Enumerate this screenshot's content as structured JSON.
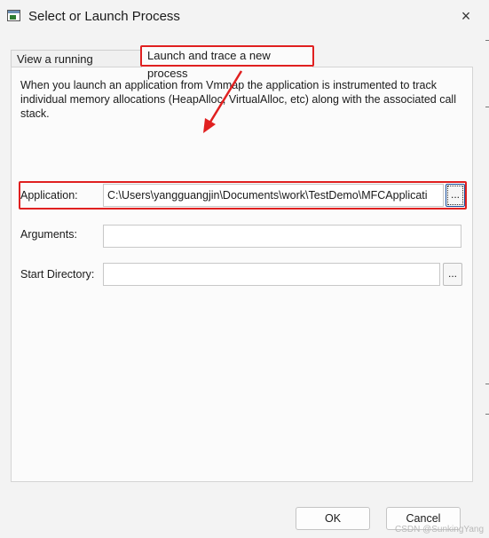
{
  "window": {
    "title": "Select or Launch Process",
    "close_icon": "×"
  },
  "tabs": [
    {
      "label": "View a running process",
      "active": false
    },
    {
      "label": "Launch and trace a new process",
      "active": true
    }
  ],
  "launch_panel": {
    "description": "When you launch an application from Vmmap the application is instrumented to track individual memory allocations (HeapAlloc, VirtualAlloc, etc) along with the associated call stack.",
    "application": {
      "label": "Application:",
      "value": "C:\\Users\\yangguangjin\\Documents\\work\\TestDemo\\MFCApplicati",
      "browse_label": "..."
    },
    "arguments": {
      "label": "Arguments:",
      "value": ""
    },
    "start_directory": {
      "label": "Start Directory:",
      "value": "",
      "browse_label": "..."
    }
  },
  "buttons": {
    "ok": "OK",
    "cancel": "Cancel"
  },
  "watermark": "CSDN @SunkingYang",
  "colors": {
    "highlight": "#e02020",
    "background": "#f3f3f3",
    "panel": "#fbfbfb"
  }
}
